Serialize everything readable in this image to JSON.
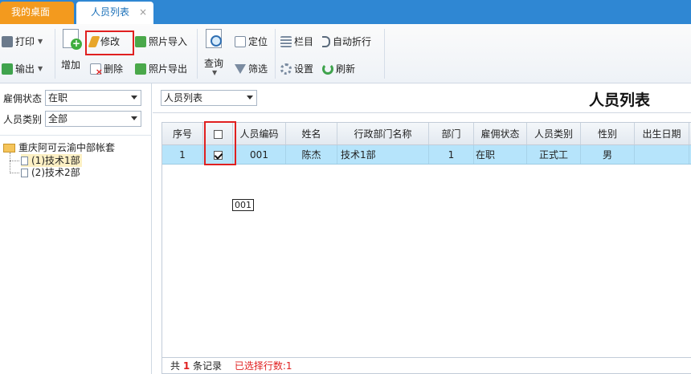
{
  "tabs": {
    "home": "我的桌面",
    "list": "人员列表",
    "close": "×"
  },
  "toolbar": {
    "print": "打印",
    "export": "输出",
    "add": "增加",
    "edit": "修改",
    "delete": "删除",
    "photo_import": "照片导入",
    "photo_export": "照片导出",
    "query": "查询",
    "locate": "定位",
    "filter": "筛选",
    "columns": "栏目",
    "wrap": "自动折行",
    "settings": "设置",
    "refresh": "刷新"
  },
  "filters": {
    "employment_label": "雇佣状态",
    "employment_value": "在职",
    "category_label": "人员类别",
    "category_value": "全部"
  },
  "tree": {
    "root": "重庆阿可云渝中部帐套",
    "children": [
      "(1)技术1部",
      "(2)技术2部"
    ]
  },
  "main": {
    "view_select": "人员列表",
    "title": "人员列表",
    "tooltip": "001"
  },
  "grid": {
    "headers": [
      "序号",
      "",
      "人员编码",
      "姓名",
      "行政部门名称",
      "部门",
      "雇佣状态",
      "人员类别",
      "性别",
      "出生日期"
    ],
    "rows": [
      {
        "seq": "1",
        "checked": true,
        "code": "001",
        "name": "陈杰",
        "admin_dept": "技术1部",
        "dept": "1",
        "status": "在职",
        "category": "正式工",
        "gender": "男",
        "birth": ""
      }
    ]
  },
  "status": {
    "total_prefix": "共",
    "total_count": "1",
    "total_suffix": "条记录",
    "selected": "已选择行数:1"
  },
  "colors": {
    "tabbar": "#2f87d3",
    "home_tab": "#f39a1e",
    "row_selected": "#b6e4fb",
    "highlight": "#e02020"
  }
}
